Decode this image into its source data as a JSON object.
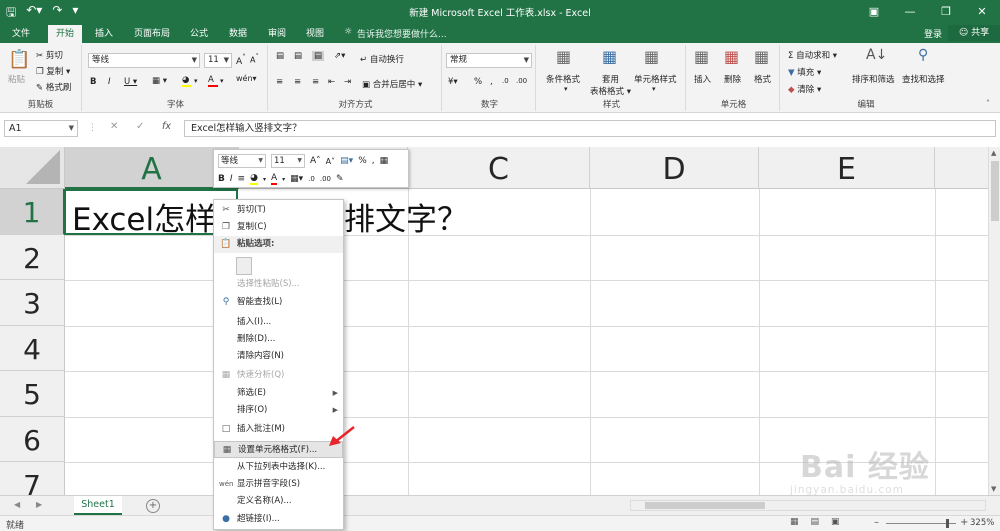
{
  "window": {
    "title": "新建 Microsoft Excel 工作表.xlsx - Excel",
    "brand_color": "#217346"
  },
  "tabs": [
    {
      "label": "文件"
    },
    {
      "label": "开始"
    },
    {
      "label": "插入"
    },
    {
      "label": "页面布局"
    },
    {
      "label": "公式"
    },
    {
      "label": "数据"
    },
    {
      "label": "审阅"
    },
    {
      "label": "视图"
    }
  ],
  "tell_me": "告诉我您想要做什么...",
  "login_label": "登录",
  "share_label": "共享",
  "ribbon": {
    "clipboard": {
      "paste": "粘贴",
      "cut": "剪切",
      "copy": "复制",
      "format_painter": "格式刷",
      "group": "剪贴板"
    },
    "font": {
      "name": "等线",
      "size": "11",
      "group": "字体"
    },
    "alignment": {
      "wrap": "自动换行",
      "merge": "合并后居中",
      "group": "对齐方式"
    },
    "number": {
      "format": "常规",
      "group": "数字"
    },
    "styles": {
      "conditional": "条件格式",
      "table_line1": "套用",
      "table_line2": "表格格式",
      "cell_styles": "单元格样式",
      "group": "样式"
    },
    "cells": {
      "insert": "插入",
      "delete": "删除",
      "format": "格式",
      "group": "单元格"
    },
    "editing": {
      "autosum": "自动求和",
      "fill": "填充",
      "clear": "清除",
      "sort": "排序和筛选",
      "find": "查找和选择",
      "group": "编辑"
    }
  },
  "formula_bar": {
    "name_box": "A1",
    "fx": "fx",
    "content": "Excel怎样输入竖排文字？"
  },
  "columns": [
    "A",
    "B",
    "C",
    "D",
    "E"
  ],
  "rows": [
    "1",
    "2",
    "3",
    "4",
    "5",
    "6",
    "7"
  ],
  "cell_a1_visible": {
    "left": "Excel怎样",
    "right": "排文字？"
  },
  "mini_toolbar": {
    "font": "等线",
    "size": "11",
    "percent": "%",
    "comma": ","
  },
  "context_menu": {
    "cut": "剪切(T)",
    "copy": "复制(C)",
    "paste_options": "粘贴选项:",
    "paste_special": "选择性粘贴(S)...",
    "smart_lookup": "智能查找(L)",
    "insert": "插入(I)...",
    "delete": "删除(D)...",
    "clear": "清除内容(N)",
    "quick_analysis": "快速分析(Q)",
    "filter": "筛选(E)",
    "sort": "排序(O)",
    "insert_comment": "插入批注(M)",
    "format_cells": "设置单元格格式(F)...",
    "pick_from_list": "从下拉列表中选择(K)...",
    "phonetic": "显示拼音字段(S)",
    "define_name": "定义名称(A)...",
    "hyperlink": "超链接(I)..."
  },
  "sheet_tabs": [
    {
      "label": "Sheet1"
    }
  ],
  "status": {
    "ready": "就绪",
    "zoom": "325%"
  },
  "watermark": {
    "brand": "Bai 经验",
    "url": "jingyan.baidu.com"
  }
}
